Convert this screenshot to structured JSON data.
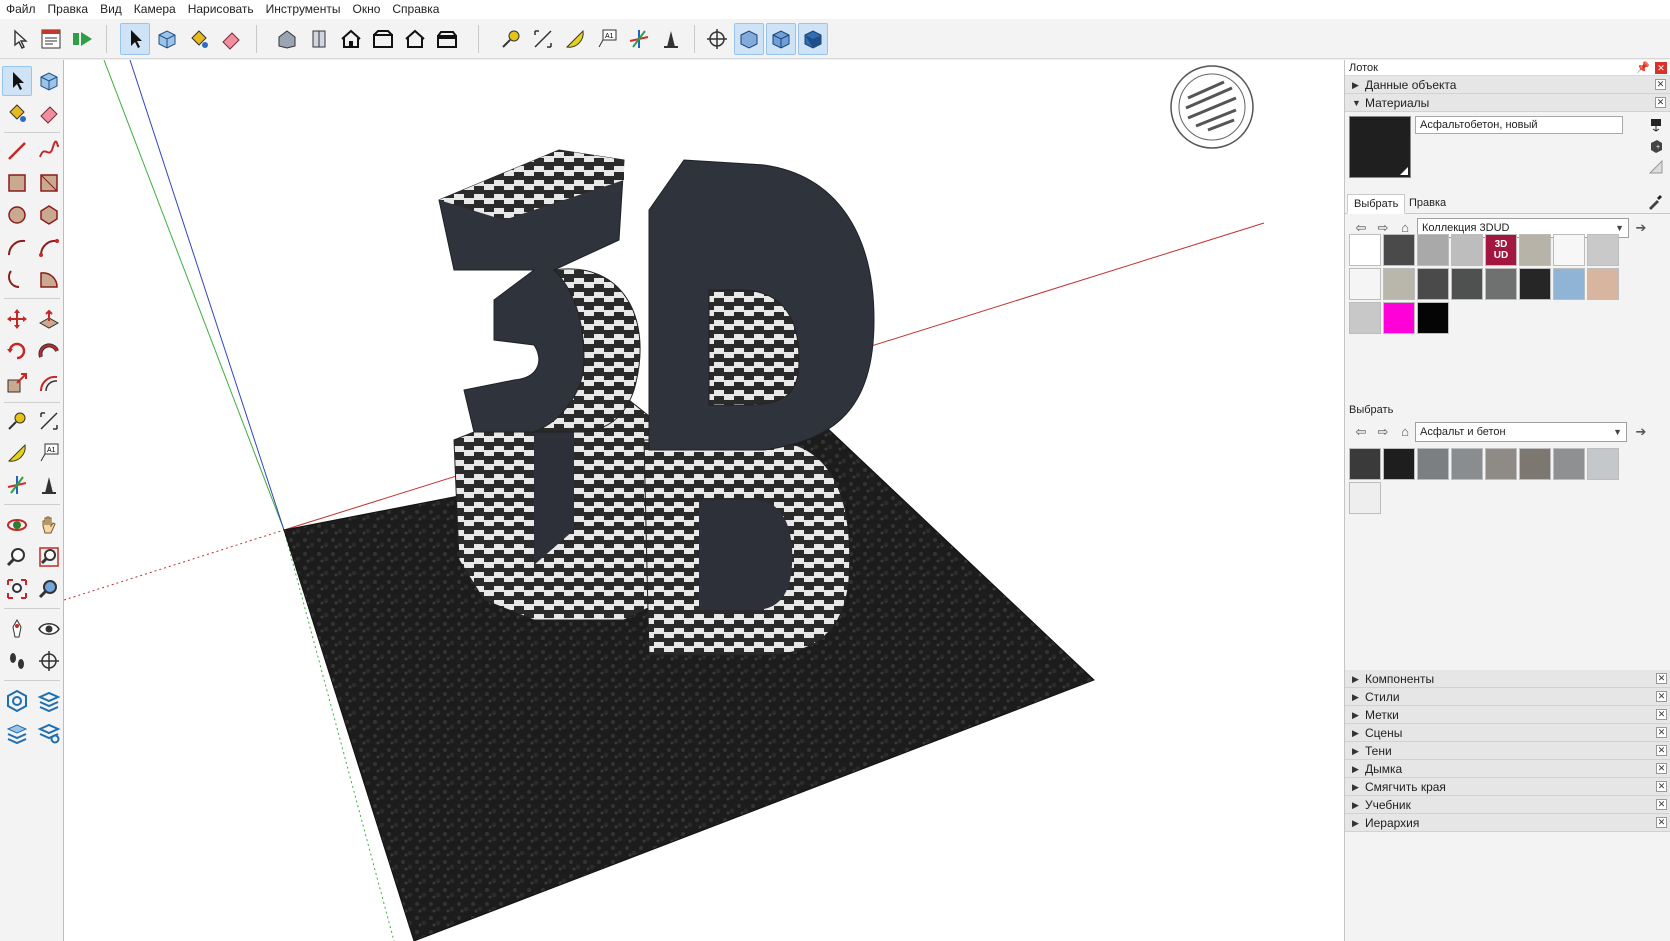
{
  "menu": [
    "Файл",
    "Правка",
    "Вид",
    "Камера",
    "Нарисовать",
    "Инструменты",
    "Окно",
    "Справка"
  ],
  "toolbar_icons": [
    "pointer-icon",
    "model-info-icon",
    "play-icon",
    "select-icon",
    "make-component-icon",
    "paint-bucket-icon",
    "eraser-icon",
    "iso-view-icon",
    "top-view-icon",
    "front-view-icon",
    "right-view-icon",
    "back-view-icon",
    "left-view-icon",
    "tape-measure-icon",
    "dimension-icon",
    "protractor-icon",
    "text-icon",
    "axes-icon",
    "3d-text-icon",
    "position-camera-icon",
    "xray-style-icon",
    "wireframe-style-icon",
    "shaded-style-icon"
  ],
  "tray": {
    "title": "Лоток",
    "object_info": "Данные объекта",
    "materials": "Материалы",
    "material_name": "Асфальтобетон, новый",
    "tab_select": "Выбрать",
    "tab_edit": "Правка",
    "collection": "Коллекция 3DUD",
    "swatches_top": [
      "#ffffff",
      "#4a4a4a",
      "#a9a9a9",
      "#bdbdbd",
      "3DUD",
      "#b8b3a8",
      "#f7f7f7",
      "#c9c9c9",
      "#f5f5f5",
      "#b9b6ac",
      "#4a4a4a",
      "#4f5050",
      "#6f7070",
      "#262626",
      "#8fb4d6",
      "#d8b59e",
      "#c8c8c8",
      "#ff00d8",
      "#050505"
    ],
    "badge_text": "3D\nUD",
    "secondary_label": "Выбрать",
    "secondary_collection": "Асфальт и бетон",
    "swatches_bottom": [
      "#3b3a3a",
      "#1e1e1e",
      "#7b7f82",
      "#8a8d8f",
      "#8e8b86",
      "#7d7772",
      "#8f9091",
      "#c5c8ca",
      "#eeeeee"
    ],
    "sections": [
      "Компоненты",
      "Стили",
      "Метки",
      "Сцены",
      "Тени",
      "Дымка",
      "Смягчить края",
      "Учебник",
      "Иерархия"
    ]
  },
  "model_text": "3DUD"
}
